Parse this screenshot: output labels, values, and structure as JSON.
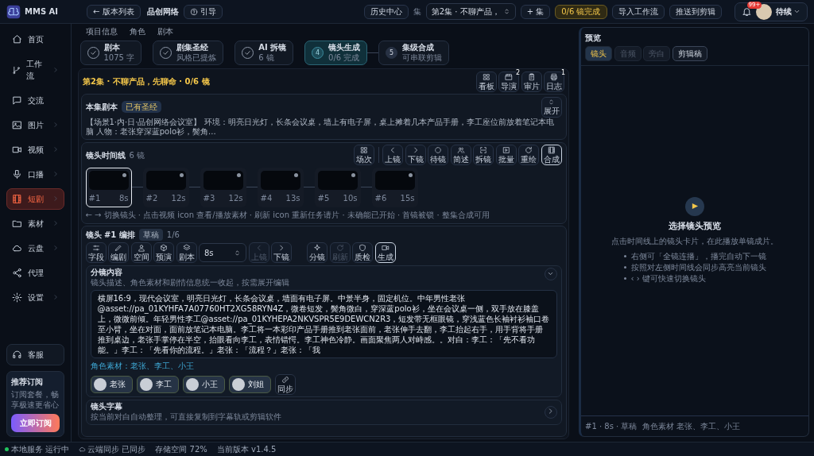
{
  "app": {
    "logo": "MMS AI"
  },
  "header": {
    "back_button": "← 版本列表",
    "project": "品创网络",
    "guide_button": "引导",
    "history_button": "历史中心",
    "episode_label": "集",
    "episode_select": "第2集 · 不聊产品，",
    "add_episode_button": "+ 集",
    "progress_badge": "0/6 镜完成",
    "import_button": "导入工作流",
    "push_button": "推送到剪辑",
    "notification_badge": "99+",
    "user_name": "待续"
  },
  "sidebar": {
    "items": [
      {
        "label": "首页",
        "selected": false,
        "submenu": false
      },
      {
        "label": "工作流",
        "selected": false,
        "submenu": true
      },
      {
        "label": "交流",
        "selected": false,
        "submenu": false
      },
      {
        "label": "图片",
        "selected": false,
        "submenu": true
      },
      {
        "label": "视频",
        "selected": false,
        "submenu": true
      },
      {
        "label": "口播",
        "selected": false,
        "submenu": true
      },
      {
        "label": "短剧",
        "selected": true,
        "submenu": true
      },
      {
        "label": "素材",
        "selected": false,
        "submenu": true
      },
      {
        "label": "云盘",
        "selected": false,
        "submenu": true
      },
      {
        "label": "代理",
        "selected": false,
        "submenu": false
      },
      {
        "label": "设置",
        "selected": false,
        "submenu": true
      }
    ],
    "support": "客服",
    "promo": {
      "title": "推荐订阅",
      "text": "订阅套餐，畅享极速更省心",
      "button": "立即订阅"
    }
  },
  "project_tabs": [
    {
      "label": "项目信息",
      "selected": false
    },
    {
      "label": "角色",
      "selected": false
    },
    {
      "label": "剧本",
      "selected": false
    }
  ],
  "steps": [
    {
      "title": "剧本",
      "subtitle": "1075 字",
      "completed": true,
      "selected": false
    },
    {
      "title": "剧集圣经",
      "subtitle": "风格已提炼",
      "completed": true,
      "selected": false
    },
    {
      "title": "AI 拆镜",
      "subtitle": "6 镜",
      "completed": true,
      "selected": false
    },
    {
      "number": "4",
      "title": "镜头生成",
      "subtitle": "0/6 完成",
      "completed": false,
      "selected": true
    },
    {
      "number": "5",
      "title": "集级合成",
      "subtitle": "可串联剪辑",
      "completed": false,
      "selected": false
    }
  ],
  "episode_heading": "第2集 · 不聊产品，先聊命 · 0/6 镜",
  "episode_tools": [
    {
      "label": "看板"
    },
    {
      "label": "导演",
      "badge": "2"
    },
    {
      "label": "审片"
    },
    {
      "label": "日志",
      "badge": "1"
    }
  ],
  "script_card": {
    "title": "本集剧本",
    "badge": "已有圣经",
    "expand_button": "展开",
    "text": "【场景1·内·日·品创网络会议室】 环境：明亮日光灯，长条会议桌，墙上有电子屏，桌上摊着几本产品手册，李工座位前放着笔记本电脑 人物：老张穿深蓝polo衫，鬓角..."
  },
  "timeline": {
    "title": "镜头时间线",
    "count": "6 镜",
    "tools": [
      {
        "label": "场次",
        "selected": false
      },
      {
        "label": "上镜",
        "selected": false
      },
      {
        "label": "下镜",
        "selected": false
      },
      {
        "label": "待镜",
        "selected": false
      },
      {
        "label": "简述",
        "selected": false
      },
      {
        "label": "拆镜",
        "selected": false
      },
      {
        "label": "批量",
        "selected": false
      },
      {
        "label": "重绘",
        "selected": false
      },
      {
        "label": "合成",
        "selected": true
      }
    ],
    "shots": [
      {
        "number": "#1",
        "duration": "8s",
        "selected": true
      },
      {
        "number": "#2",
        "duration": "12s",
        "selected": false
      },
      {
        "number": "#3",
        "duration": "12s",
        "selected": false
      },
      {
        "number": "#4",
        "duration": "13s",
        "selected": false
      },
      {
        "number": "#5",
        "duration": "10s",
        "selected": false
      },
      {
        "number": "#6",
        "duration": "15s",
        "selected": false
      }
    ],
    "hint": "← → 切换镜头 · 点击视频 icon 查看/播放素材 · 刷新 icon 重新任务请片 · 未确能已开始 · 首镜被锁 · 整集合成可用"
  },
  "editor": {
    "title": "镜头 #1 编排",
    "status_badge": "草稿",
    "position": "1/6",
    "tools": [
      {
        "label": "字段",
        "disabled": false,
        "selected": false
      },
      {
        "label": "编剧",
        "disabled": false,
        "selected": false
      },
      {
        "label": "空间",
        "disabled": false,
        "selected": false
      },
      {
        "label": "预演",
        "disabled": false,
        "selected": false
      },
      {
        "label": "剧本",
        "disabled": false,
        "selected": false
      }
    ],
    "duration": "8s",
    "nav": [
      {
        "label": "上镜",
        "disabled": true,
        "selected": false
      },
      {
        "label": "下镜",
        "disabled": false,
        "selected": false
      }
    ],
    "actions": [
      {
        "label": "分镜",
        "disabled": false,
        "selected": false
      },
      {
        "label": "刷新",
        "disabled": true,
        "selected": false
      },
      {
        "label": "质检",
        "disabled": false,
        "selected": false
      },
      {
        "label": "生成",
        "disabled": false,
        "selected": true
      }
    ]
  },
  "storyboard": {
    "title": "分镜内容",
    "subtitle": "镜头描述、角色素材和剧情信息统一收起，按需展开编辑",
    "text": "横屏16:9，现代会议室，明亮日光灯，长条会议桌，墙面有电子屏。中景半身，固定机位。中年男性老张@asset://pa_01KYHFA7A07760HT2XG58RYN4Z，微卷短发，鬓角微白，穿深蓝polo衫，坐在会议桌一侧，双手放在膝盖上，微微前倾。年轻男性李工@asset://pa_01KYHEPA2NKVSPR5E9DEWCN2R3，短发带无框眼镜，穿浅蓝色长袖衬衫袖口卷至小臂，坐在对面，面前放笔记本电脑。李工将一本彩印产品手册推到老张面前，老张伸手去翻，李工抬起右手，用手背将手册推到桌边，老张手掌停在半空，抬眼看向李工，表情错愕。李工神色冷静。画面聚焦两人对峙感。。对白：李工：「先不看功能。」李工：「先看你的流程。」老张：「流程？」老张：「我",
    "assets_line": "角色素材：老张、李工、小王",
    "characters": [
      {
        "name": "老张"
      },
      {
        "name": "李工"
      },
      {
        "name": "小王"
      },
      {
        "name": "刘姐"
      }
    ],
    "sync_button": "同步"
  },
  "subtitles": {
    "title": "镜头字幕",
    "subtitle": "按当前对白自动整理，可直接复制到字幕轨或剪辑软件"
  },
  "preview": {
    "title": "预览",
    "tabs": [
      {
        "label": "镜头",
        "selected": true,
        "disabled": false
      },
      {
        "label": "音频",
        "selected": false,
        "disabled": true
      },
      {
        "label": "旁白",
        "selected": false,
        "disabled": true
      },
      {
        "label": "剪辑稿",
        "selected": false,
        "disabled": false
      }
    ],
    "empty_title": "选择镜头预览",
    "empty_text": "点击时间线上的镜头卡片，在此播放单镜成片。",
    "tips": [
      "右侧可「全镜连播」，播完自动下一镜",
      "按照对左侧时间线会同步高亮当前镜头",
      "‹ › 键可快速切换镜头"
    ],
    "footer": "#1 · 8s · 草稿  角色素材 老张、李工、小王"
  },
  "status_bar": [
    {
      "label": "本地服务 运行中",
      "kind": "dot"
    },
    {
      "label": "云端同步 已同步",
      "kind": "cloud"
    },
    {
      "label": "存储空间 72%",
      "kind": "text"
    },
    {
      "label": "当前版本 v1.4.5",
      "kind": "text"
    }
  ]
}
